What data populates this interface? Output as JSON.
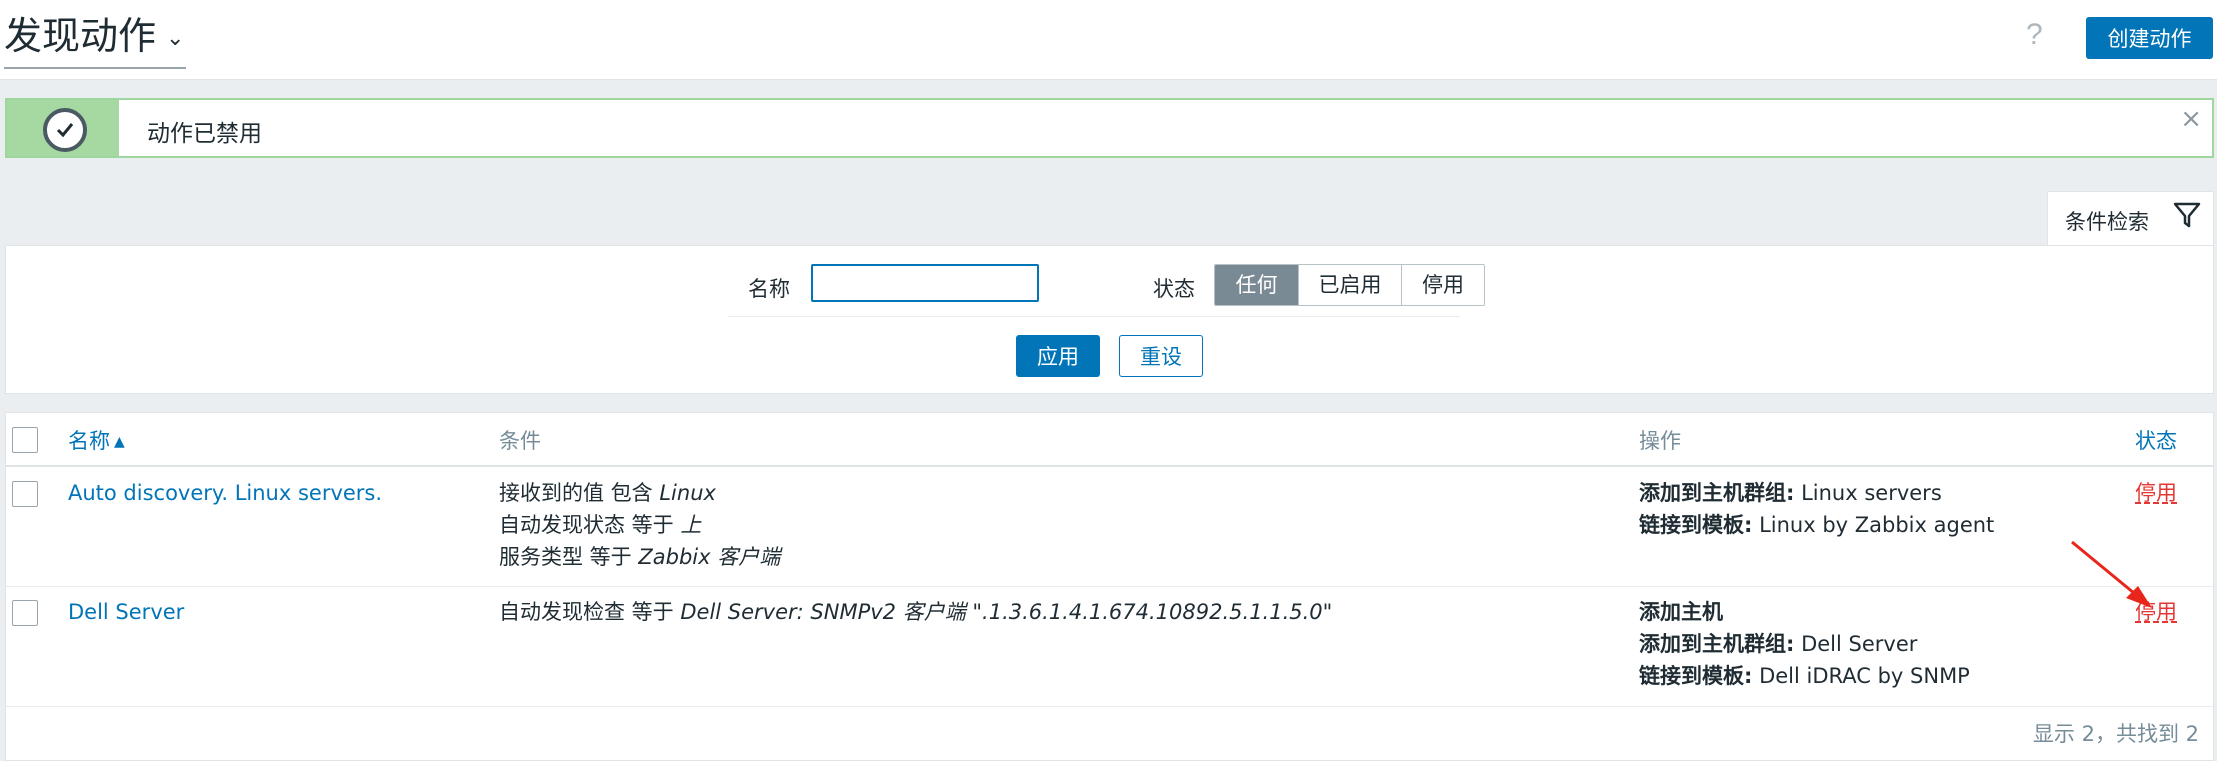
{
  "header": {
    "title": "发现动作",
    "title_chevron": "⌄",
    "help": "?",
    "create_button": "创建动作"
  },
  "message": {
    "text": "动作已禁用",
    "close": "×"
  },
  "filter": {
    "tab_label": "条件检索",
    "name_label": "名称",
    "name_value": "",
    "status_label": "状态",
    "status_options": [
      "任何",
      "已启用",
      "停用"
    ],
    "status_selected": "任何",
    "apply": "应用",
    "reset": "重设"
  },
  "table": {
    "columns": {
      "name": "名称",
      "name_sort": "▲",
      "conditions": "条件",
      "operations": "操作",
      "status": "状态"
    },
    "rows": [
      {
        "name": "Auto discovery. Linux servers.",
        "conditions": [
          {
            "prefix": "接收到的值 包含 ",
            "value": "Linux"
          },
          {
            "prefix": "自动发现状态 等于 ",
            "value": "上"
          },
          {
            "prefix": "服务类型 等于 ",
            "value": "Zabbix 客户端"
          }
        ],
        "operations": [
          {
            "label": "添加到主机群组:",
            "value": " Linux servers"
          },
          {
            "label": "链接到模板:",
            "value": " Linux by Zabbix agent"
          }
        ],
        "status": "停用"
      },
      {
        "name": "Dell Server",
        "conditions": [
          {
            "prefix": "自动发现检查 等于 ",
            "value": "Dell Server: SNMPv2 客户端 \".1.3.6.1.4.1.674.10892.5.1.1.5.0\""
          }
        ],
        "operations": [
          {
            "label": "添加主机",
            "value": ""
          },
          {
            "label": "添加到主机群组:",
            "value": " Dell Server"
          },
          {
            "label": "链接到模板:",
            "value": " Dell iDRAC by SNMP"
          }
        ],
        "status": "停用"
      }
    ],
    "footer": "显示 2，共找到 2"
  },
  "colors": {
    "accent": "#0275b8",
    "disabled_red": "#e33734",
    "success_green": "#a6d9a2",
    "annotation_arrow": "#e8261c"
  }
}
